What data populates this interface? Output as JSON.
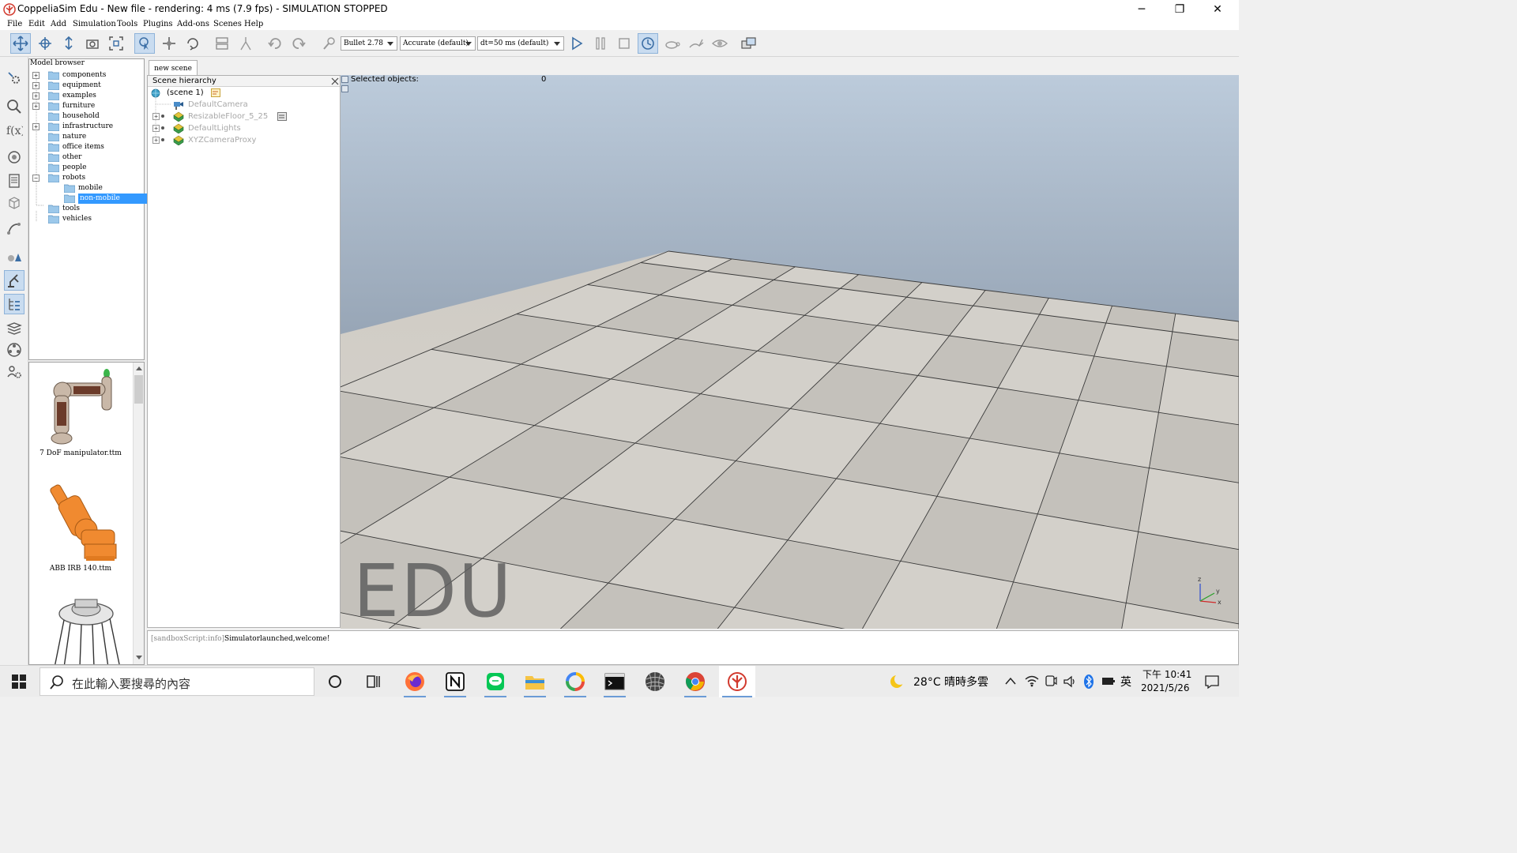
{
  "window": {
    "title": "CoppeliaSim Edu - New file - rendering: 4 ms (7.9 fps) - SIMULATION STOPPED",
    "minimize_glyph": "─",
    "maximize_glyph": "❐",
    "close_glyph": "✕"
  },
  "menu": [
    "File",
    "Edit",
    "Add",
    "Simulation",
    "Tools",
    "Plugins",
    "Add-ons",
    "Scenes",
    "Help"
  ],
  "toolbar": {
    "engine": "Bullet 2.78",
    "accuracy": "Accurate (default)",
    "timestep": "dt=50 ms (default)"
  },
  "model_browser": {
    "title": "Model browser",
    "items": [
      {
        "label": "components"
      },
      {
        "label": "equipment"
      },
      {
        "label": "examples"
      },
      {
        "label": "furniture"
      },
      {
        "label": "household"
      },
      {
        "label": "infrastructure"
      },
      {
        "label": "nature"
      },
      {
        "label": "office items"
      },
      {
        "label": "other"
      },
      {
        "label": "people"
      },
      {
        "label": "robots"
      },
      {
        "label": "mobile"
      },
      {
        "label": "non-mobile"
      },
      {
        "label": "tools"
      },
      {
        "label": "vehicles"
      }
    ],
    "thumbnails": [
      {
        "label": "7 DoF manipulator.ttm"
      },
      {
        "label": "ABB IRB 140.ttm"
      }
    ]
  },
  "scene_tab": "new scene",
  "scene_hierarchy": {
    "title": "Scene hierarchy",
    "items": [
      {
        "label": "(scene 1)"
      },
      {
        "label": "DefaultCamera"
      },
      {
        "label": "ResizableFloor_5_25"
      },
      {
        "label": "DefaultLights"
      },
      {
        "label": "XYZCameraProxy"
      }
    ]
  },
  "viewport": {
    "selected_label": "Selected objects:",
    "selected_count": "0",
    "watermark": "EDU",
    "axis_x": "x",
    "axis_y": "y",
    "axis_z": "z"
  },
  "console": {
    "prefix": "[sandboxScript:info]",
    "message": "Simulatorlaunched,welcome!"
  },
  "taskbar": {
    "search_placeholder": "在此輸入要搜尋的內容",
    "weather": "28°C  晴時多雲",
    "ime": "英",
    "time": "下午 10:41",
    "date": "2021/5/26"
  },
  "colors": {
    "selection": "#3399ff",
    "sky_top": "#b9cadb",
    "sky_bottom": "#6f7d8e",
    "accent": "#6b9bd6"
  }
}
